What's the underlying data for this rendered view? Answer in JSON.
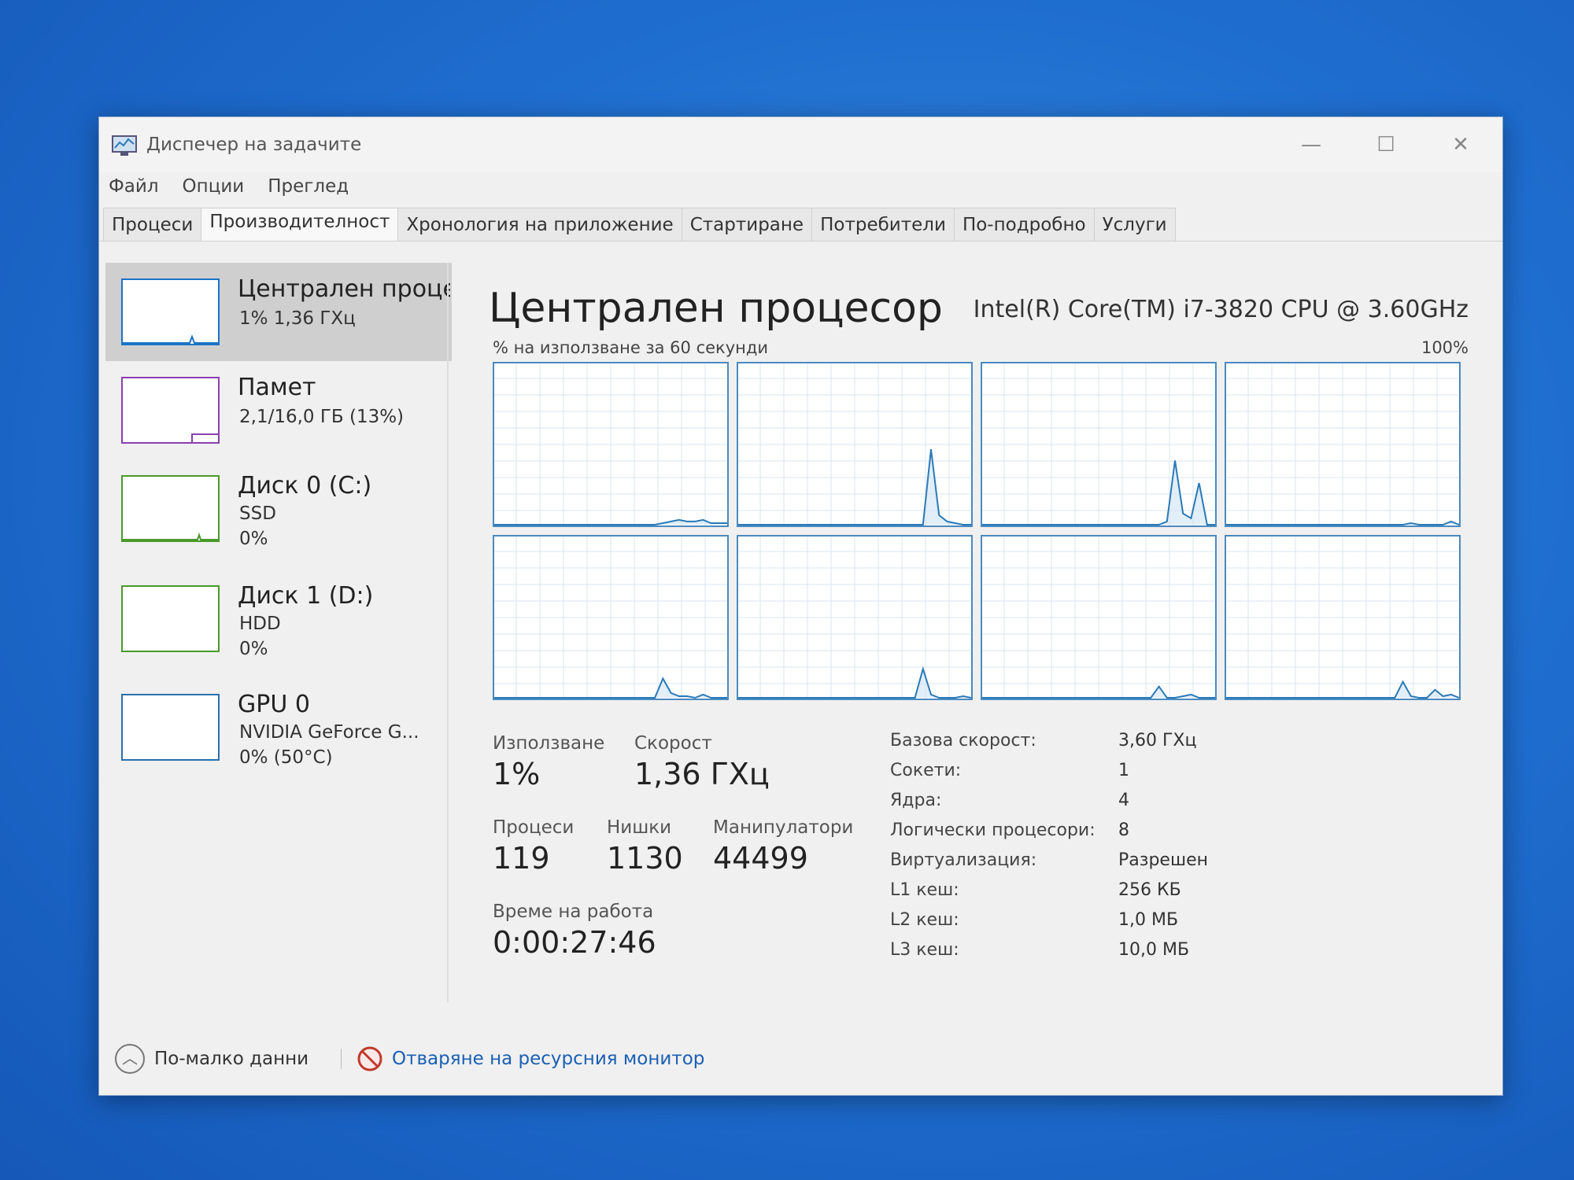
{
  "window": {
    "title": "Диспечер на задачите",
    "controls": {
      "minimize": "—",
      "maximize": "☐",
      "close": "✕"
    }
  },
  "menu": [
    "Файл",
    "Опции",
    "Преглед"
  ],
  "tabs": [
    {
      "label": "Процеси",
      "active": false
    },
    {
      "label": "Производителност",
      "active": true
    },
    {
      "label": "Хронология на приложение",
      "active": false
    },
    {
      "label": "Стартиране",
      "active": false
    },
    {
      "label": "Потребители",
      "active": false
    },
    {
      "label": "По-подробно",
      "active": false
    },
    {
      "label": "Услуги",
      "active": false
    }
  ],
  "sidebar": {
    "items": [
      {
        "title": "Централен проце",
        "sub1": "1% 1,36 ГХц",
        "sub2": "",
        "color": "#1a73c7",
        "selected": true
      },
      {
        "title": "Памет",
        "sub1": "2,1/16,0 ГБ (13%)",
        "sub2": "",
        "color": "#8a3fb0",
        "selected": false
      },
      {
        "title": "Диск 0 (C:)",
        "sub1": "SSD",
        "sub2": "0%",
        "color": "#4a9a2a",
        "selected": false
      },
      {
        "title": "Диск 1 (D:)",
        "sub1": "HDD",
        "sub2": "0%",
        "color": "#4a9a2a",
        "selected": false
      },
      {
        "title": "GPU 0",
        "sub1": "NVIDIA GeForce G...",
        "sub2": "0% (50°C)",
        "color": "#2a6fb0",
        "selected": false
      }
    ]
  },
  "cpu": {
    "title": "Централен процесор",
    "model": "Intel(R) Core(TM) i7-3820 CPU @ 3.60GHz",
    "graph_label": "% на използване за 60 секунди",
    "graph_max": "100%",
    "line_color": "#2a7ab8",
    "grid_color": "#d8e6f2",
    "border_color": "#4a8ac0"
  },
  "chart_data": {
    "type": "line",
    "title": "",
    "ylim": [
      0,
      100
    ],
    "x": [
      0,
      1,
      2,
      3,
      4,
      5,
      6,
      7,
      8,
      9,
      10,
      11,
      12,
      13,
      14,
      15,
      16,
      17,
      18,
      19,
      20,
      21,
      22,
      23,
      24,
      25,
      26,
      27,
      28,
      29
    ],
    "series": [
      {
        "values": [
          0,
          0,
          0,
          0,
          0,
          0,
          0,
          0,
          0,
          0,
          0,
          0,
          0,
          0,
          0,
          0,
          0,
          0,
          0,
          0,
          0,
          1,
          2,
          3,
          2,
          2,
          3,
          1,
          1,
          1
        ]
      },
      {
        "values": [
          0,
          0,
          0,
          0,
          0,
          0,
          0,
          0,
          0,
          0,
          0,
          0,
          0,
          0,
          0,
          0,
          0,
          0,
          0,
          0,
          0,
          0,
          0,
          0,
          47,
          6,
          2,
          1,
          0,
          0
        ]
      },
      {
        "values": [
          0,
          0,
          0,
          0,
          0,
          0,
          0,
          0,
          0,
          0,
          0,
          0,
          0,
          0,
          0,
          0,
          0,
          0,
          0,
          0,
          0,
          0,
          0,
          2,
          40,
          7,
          4,
          26,
          0,
          0
        ]
      },
      {
        "values": [
          0,
          0,
          0,
          0,
          0,
          0,
          0,
          0,
          0,
          0,
          0,
          0,
          0,
          0,
          0,
          0,
          0,
          0,
          0,
          0,
          0,
          0,
          0,
          1,
          0,
          0,
          0,
          0,
          2,
          0
        ]
      },
      {
        "values": [
          0,
          0,
          0,
          0,
          0,
          0,
          0,
          0,
          0,
          0,
          0,
          0,
          0,
          0,
          0,
          0,
          0,
          0,
          0,
          0,
          0,
          12,
          3,
          1,
          1,
          0,
          2,
          0,
          0,
          0
        ]
      },
      {
        "values": [
          0,
          0,
          0,
          0,
          0,
          0,
          0,
          0,
          0,
          0,
          0,
          0,
          0,
          0,
          0,
          0,
          0,
          0,
          0,
          0,
          0,
          0,
          0,
          18,
          2,
          0,
          0,
          0,
          1,
          0
        ]
      },
      {
        "values": [
          0,
          0,
          0,
          0,
          0,
          0,
          0,
          0,
          0,
          0,
          0,
          0,
          0,
          0,
          0,
          0,
          0,
          0,
          0,
          0,
          0,
          0,
          7,
          0,
          0,
          1,
          2,
          0,
          0,
          0
        ]
      },
      {
        "values": [
          0,
          0,
          0,
          0,
          0,
          0,
          0,
          0,
          0,
          0,
          0,
          0,
          0,
          0,
          0,
          0,
          0,
          0,
          0,
          0,
          0,
          0,
          10,
          1,
          0,
          0,
          5,
          1,
          2,
          0
        ]
      }
    ]
  },
  "stats": {
    "usage_label": "Използване",
    "usage_value": "1%",
    "speed_label": "Скорост",
    "speed_value": "1,36 ГХц",
    "proc_label": "Процеси",
    "proc_value": "119",
    "threads_label": "Нишки",
    "threads_value": "1130",
    "handles_label": "Манипулатори",
    "handles_value": "44499",
    "uptime_label": "Време на работа",
    "uptime_value": "0:00:27:46"
  },
  "info": [
    {
      "label": "Базова скорост:",
      "value": "3,60 ГХц"
    },
    {
      "label": "Сокети:",
      "value": "1"
    },
    {
      "label": "Ядра:",
      "value": "4"
    },
    {
      "label": "Логически процесори:",
      "value": "8"
    },
    {
      "label": "Виртуализация:",
      "value": "Разрешен"
    },
    {
      "label": "L1 кеш:",
      "value": "256 КБ"
    },
    {
      "label": "L2 кеш:",
      "value": "1,0 МБ"
    },
    {
      "label": "L3 кеш:",
      "value": "10,0 МБ"
    }
  ],
  "footer": {
    "fewer_details": "По-малко данни",
    "resource_monitor": "Отваряне на ресурсния монитор"
  }
}
